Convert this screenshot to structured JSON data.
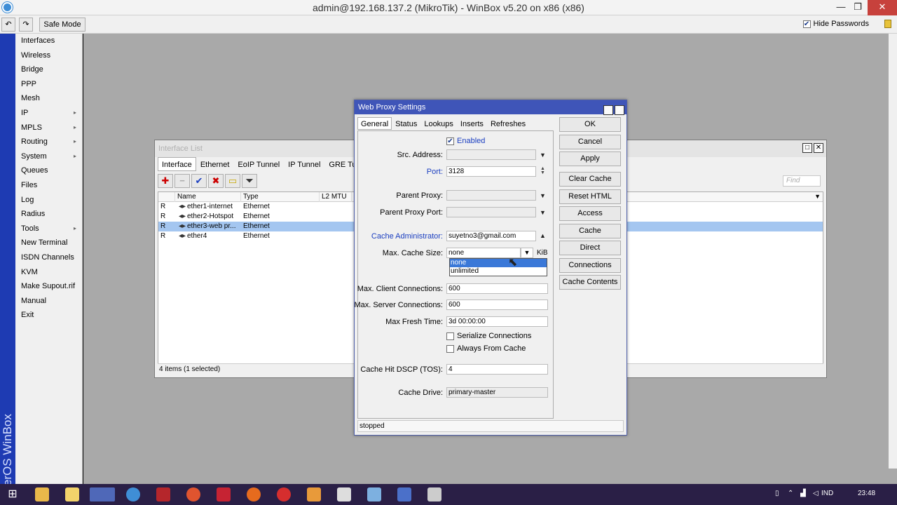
{
  "window": {
    "title": "admin@192.168.137.2 (MikroTik) - WinBox v5.20 on x86 (x86)",
    "min": "—",
    "max": "❐",
    "close": "✕"
  },
  "toolbar": {
    "undo": "↶",
    "redo": "↷",
    "safe_mode": "Safe Mode",
    "hide_passwords": "Hide Passwords",
    "hide_passwords_checked": "✔"
  },
  "sidebar": {
    "brand": "RouterOS WinBox",
    "items": [
      "Interfaces",
      "Wireless",
      "Bridge",
      "PPP",
      "Mesh",
      "IP",
      "MPLS",
      "Routing",
      "System",
      "Queues",
      "Files",
      "Log",
      "Radius",
      "Tools",
      "New Terminal",
      "ISDN Channels",
      "KVM",
      "Make Supout.rif",
      "Manual",
      "Exit"
    ],
    "submenu_arrow": "▸"
  },
  "interface_list": {
    "title": "Interface List",
    "tabs": [
      "Interface",
      "Ethernet",
      "EoIP Tunnel",
      "IP Tunnel",
      "GRE Tunnel"
    ],
    "tools": {
      "add": "✚",
      "remove": "−",
      "enable": "✔",
      "disable": "✖",
      "comment": "▭",
      "filter": "⏷"
    },
    "find_placeholder": "Find",
    "columns": [
      "",
      "Name",
      "Type",
      "L2 MTU"
    ],
    "rows": [
      {
        "flag": "R",
        "name": "ether1-internet",
        "type": "Ethernet"
      },
      {
        "flag": "R",
        "name": "ether2-Hotspot",
        "type": "Ethernet"
      },
      {
        "flag": "R",
        "name": "ether3-web pr...",
        "type": "Ethernet"
      },
      {
        "flag": "R",
        "name": "ether4",
        "type": "Ethernet"
      }
    ],
    "status": "4 items (1 selected)"
  },
  "web_proxy": {
    "title": "Web Proxy Settings",
    "tabs": [
      "General",
      "Status",
      "Lookups",
      "Inserts",
      "Refreshes"
    ],
    "enabled_label": "Enabled",
    "enabled_check": "✔",
    "src_address_label": "Src. Address:",
    "port_label": "Port:",
    "port_value": "3128",
    "parent_proxy_label": "Parent Proxy:",
    "parent_proxy_port_label": "Parent Proxy Port:",
    "cache_admin_label": "Cache Administrator:",
    "cache_admin_value": "suyetno3@gmail.com",
    "max_cache_size_label": "Max. Cache Size:",
    "max_cache_size_value": "none",
    "max_cache_size_unit": "KiB",
    "cache_size_options": [
      "none",
      "unlimited"
    ],
    "max_client_conn_label": "Max. Client Connections:",
    "max_client_conn_value": "600",
    "max_server_conn_label": "Max. Server Connections:",
    "max_server_conn_value": "600",
    "max_fresh_time_label": "Max Fresh Time:",
    "max_fresh_time_value": "3d 00:00:00",
    "serialize_label": "Serialize Connections",
    "always_cache_label": "Always From Cache",
    "cache_hit_dscp_label": "Cache Hit DSCP (TOS):",
    "cache_hit_dscp_value": "4",
    "cache_drive_label": "Cache Drive:",
    "cache_drive_value": "primary-master",
    "buttons": [
      "OK",
      "Cancel",
      "Apply",
      "Clear Cache",
      "Reset HTML",
      "Access",
      "Cache",
      "Direct",
      "Connections",
      "Cache Contents"
    ],
    "status": "stopped"
  },
  "taskbar": {
    "lang": "IND",
    "time": "23:48"
  },
  "colors": {
    "accent": "#3f55b8",
    "sidebar_brand": "#1e3bb3",
    "taskbar": "#2a1f46"
  }
}
